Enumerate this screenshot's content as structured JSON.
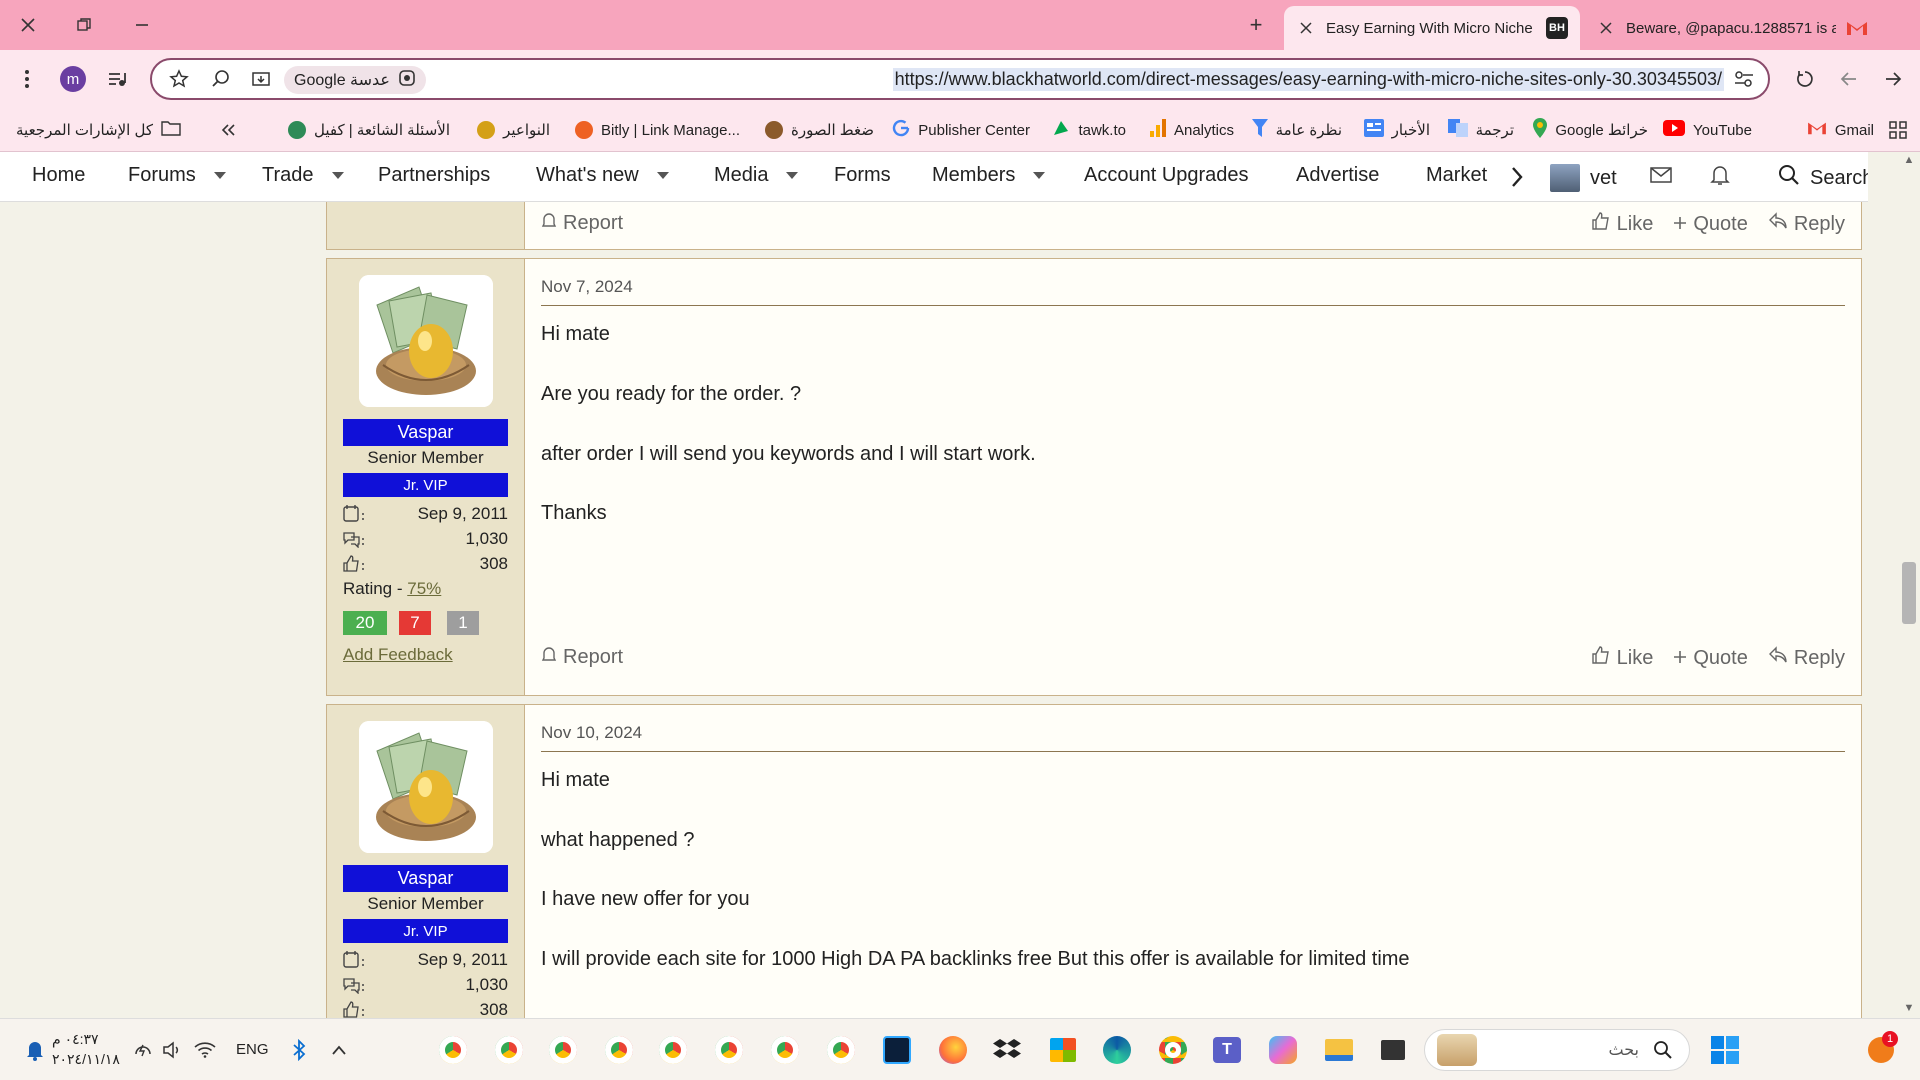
{
  "browser": {
    "tabs": [
      {
        "title": "Easy Earning With Micro Niche",
        "active": true
      },
      {
        "title": "Beware, @papacu.1288571 is a",
        "active": false
      }
    ],
    "profile_initial": "m",
    "lens_chip": "Google عدسة",
    "url": "https://www.blackhatworld.com/direct-messages/easy-earning-with-micro-niche-sites-only-30.30345503/",
    "bookmarks": [
      {
        "label": "كل الإشارات المرجعية",
        "color": "#555"
      },
      {
        "label": "الأسئلة الشائعة | كفيل",
        "color": "#2e8b57"
      },
      {
        "label": "النواعير",
        "color": "#d4a017"
      },
      {
        "label": "Bitly | Link Manage...",
        "color": "#ee6123"
      },
      {
        "label": "ضغط الصورة",
        "color": "#8b5a2b"
      },
      {
        "label": "Publisher Center",
        "color": "#4285f4"
      },
      {
        "label": "tawk.to",
        "color": "#03a84e"
      },
      {
        "label": "Analytics",
        "color": "#f9ab00"
      },
      {
        "label": "نظرة عامة",
        "color": "#4285f4"
      },
      {
        "label": "الأخبار",
        "color": "#4285f4"
      },
      {
        "label": "ترجمة",
        "color": "#4285f4"
      },
      {
        "label": "Google خرائط",
        "color": "#34a853"
      },
      {
        "label": "YouTube",
        "color": "#ff0000"
      },
      {
        "label": "Gmail",
        "color": "#ea4335"
      }
    ]
  },
  "sitenav": {
    "items": [
      "Home",
      "Forums",
      "Trade",
      "Partnerships",
      "What's new",
      "Media",
      "Forms",
      "Members",
      "Account Upgrades",
      "Advertise",
      "Market"
    ],
    "user": "vet",
    "search": "Search"
  },
  "prev_actions": {
    "report": "Report",
    "like": "Like",
    "quote": "Quote",
    "reply": "Reply"
  },
  "messages": [
    {
      "user": {
        "name": "Vaspar",
        "title": "Senior Member",
        "badge": "Jr. VIP",
        "joined": "Sep 9, 2011",
        "messages": "1,030",
        "reactions": "308",
        "rating_label": "Rating - ",
        "rating_value": "75%",
        "feedback": [
          "20",
          "7",
          "1"
        ],
        "add_feedback": "Add Feedback"
      },
      "date": "Nov 7, 2024",
      "lines": [
        "Hi mate",
        "Are you ready for the order. ?",
        "after order I will send you keywords and I will start work.",
        "Thanks"
      ],
      "actions": {
        "report": "Report",
        "like": "Like",
        "quote": "Quote",
        "reply": "Reply"
      }
    },
    {
      "user": {
        "name": "Vaspar",
        "title": "Senior Member",
        "badge": "Jr. VIP",
        "joined": "Sep 9, 2011",
        "messages": "1,030",
        "reactions": "308"
      },
      "date": "Nov 10, 2024",
      "lines": [
        "Hi mate",
        "what happened ?",
        "I have new offer for you",
        "I will provide each site for 1000 High DA PA backlinks free But this offer is available for limited time"
      ]
    }
  ],
  "taskbar": {
    "time": "٠٤:٣٧ م",
    "date": "٢٠٢٤/١١/١٨",
    "lang": "ENG",
    "search_placeholder": "بحث",
    "notif_count": "1"
  },
  "colors": {
    "tabbar": "#f7a5bd",
    "chrome": "#fde7ee",
    "name_badge": "#1010d8",
    "side": "#eae3c9",
    "fb_pos": "#4caf50",
    "fb_neg": "#e53935",
    "fb_neu": "#9e9e9e"
  }
}
